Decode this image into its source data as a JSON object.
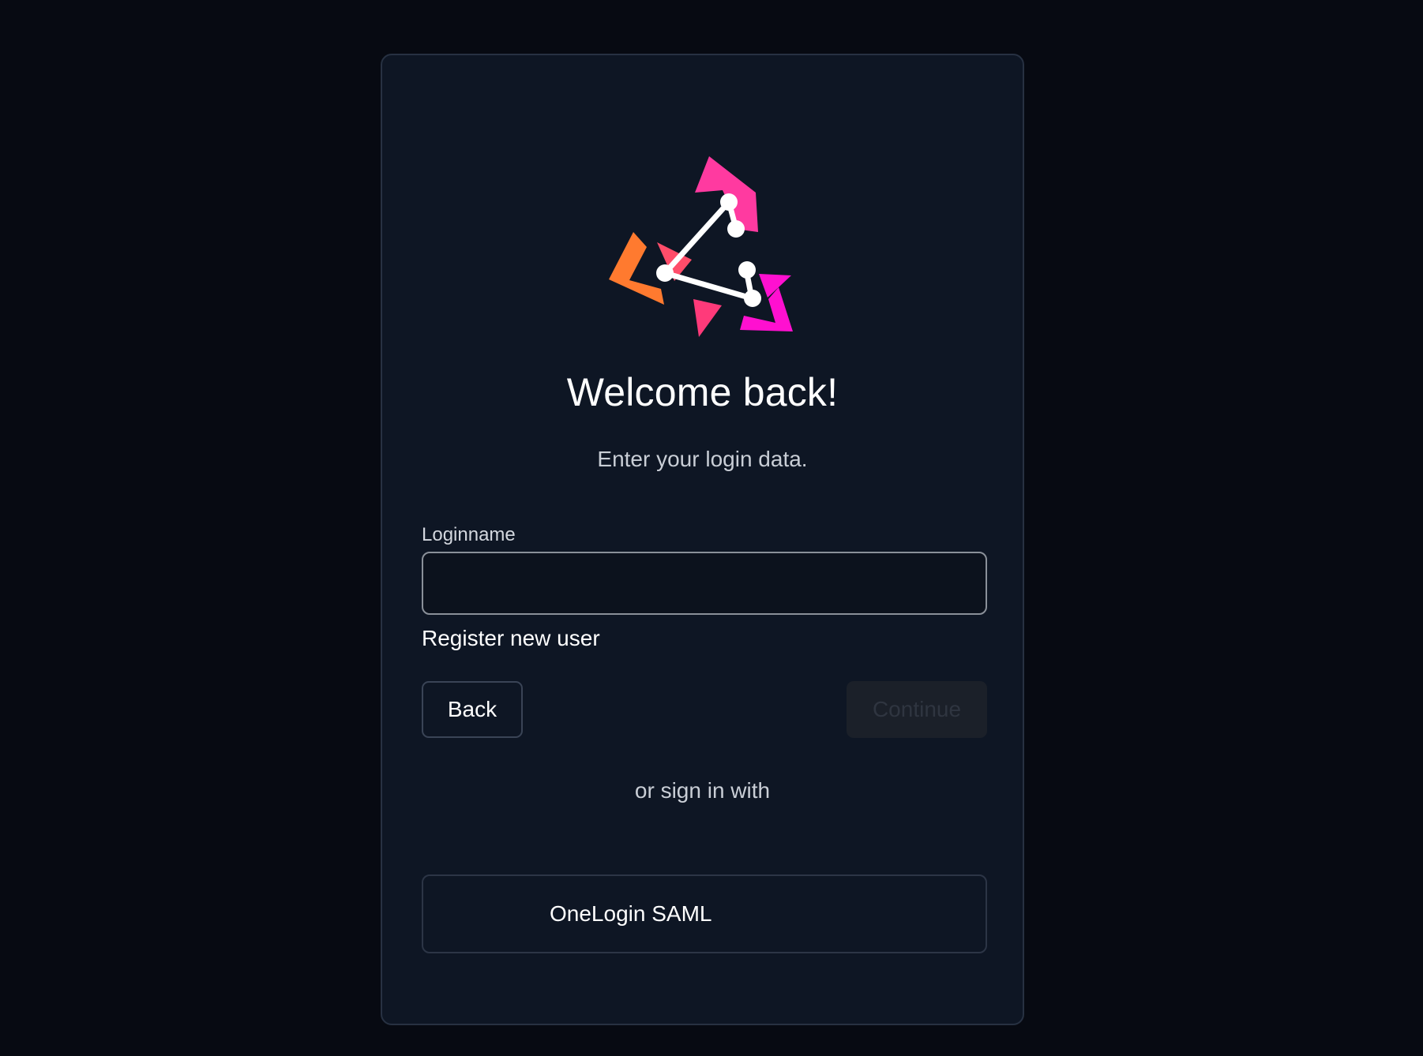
{
  "brand": {
    "colors": {
      "orange": "#ff7a2f",
      "coral": "#ff4d6a",
      "pink": "#ff2aa0",
      "magenta": "#ff10d0",
      "background": "#070a12",
      "card": "#0e1624"
    }
  },
  "login": {
    "title": "Welcome back!",
    "subtitle": "Enter your login data.",
    "loginname_label": "Loginname",
    "loginname_value": "",
    "register_link": "Register new user",
    "back_label": "Back",
    "continue_label": "Continue",
    "divider_text": "or sign in with",
    "idp_label": "OneLogin SAML"
  }
}
